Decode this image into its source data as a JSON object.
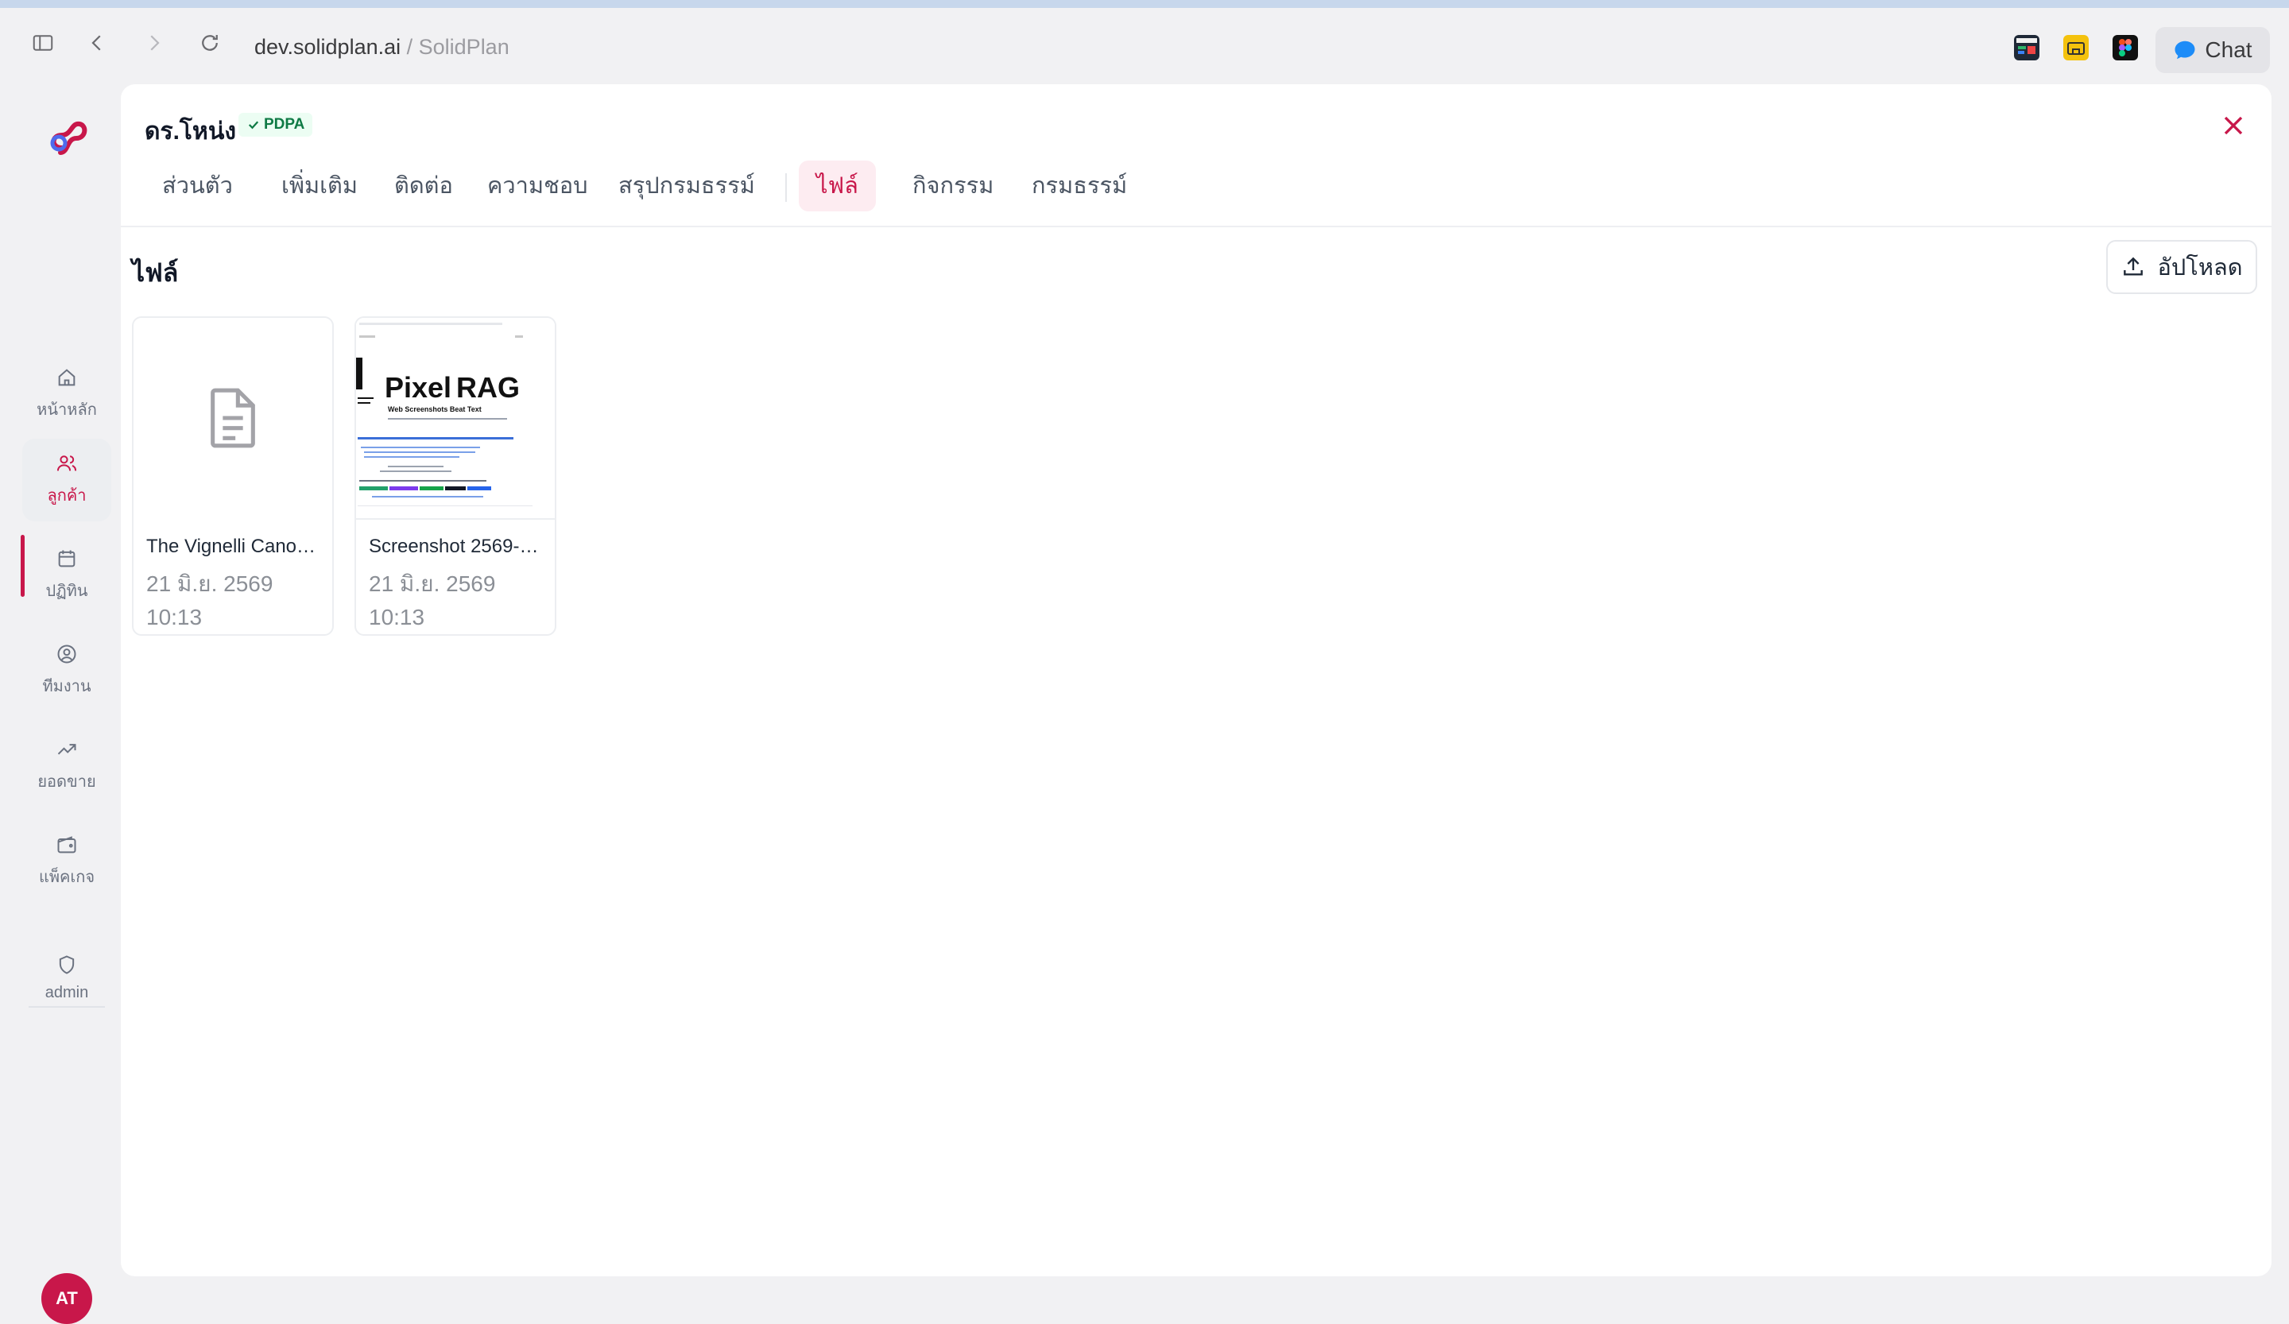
{
  "browser": {
    "url_domain": "dev.solidplan.ai",
    "url_separator": " / ",
    "url_title": "SolidPlan",
    "chat_label": "Chat"
  },
  "sidebar": {
    "items": [
      {
        "label": "หน้าหลัก",
        "icon": "home-icon"
      },
      {
        "label": "ลูกค้า",
        "icon": "users-icon",
        "active": true
      },
      {
        "label": "ปฏิทิน",
        "icon": "calendar-icon"
      },
      {
        "label": "ทีมงาน",
        "icon": "user-circle-icon"
      },
      {
        "label": "ยอดขาย",
        "icon": "trending-up-icon"
      },
      {
        "label": "แพ็คเกจ",
        "icon": "wallet-icon"
      },
      {
        "label": "admin",
        "icon": "shield-icon"
      }
    ],
    "avatar_initials": "AT"
  },
  "customer": {
    "name": "ดร.โหน่ง",
    "badge": "PDPA"
  },
  "tabs": [
    {
      "label": "ส่วนตัว"
    },
    {
      "label": "เพิ่มเติม"
    },
    {
      "label": "ติดต่อ"
    },
    {
      "label": "ความชอบ"
    },
    {
      "label": "สรุปกรมธรรม์"
    },
    {
      "label": "ไฟล์",
      "active": true
    },
    {
      "label": "กิจกรรม"
    },
    {
      "label": "กรมธรรม์"
    }
  ],
  "files_section": {
    "title": "ไฟล์",
    "upload_label": "อัปโหลด",
    "files": [
      {
        "name": "The Vignelli Canon....",
        "date": "21 มิ.ย. 2569",
        "time": "10:13",
        "thumb": "document-icon"
      },
      {
        "name": "Screenshot 2569-0...",
        "date": "21 มิ.ย. 2569",
        "time": "10:13",
        "thumb": "screenshot",
        "thumb_title_a": "Pixel",
        "thumb_title_b": "RAG",
        "thumb_subtitle": "Web Screenshots Beat Text"
      }
    ]
  },
  "colors": {
    "accent": "#c8174a",
    "pdpa_green": "#0f7a45"
  }
}
